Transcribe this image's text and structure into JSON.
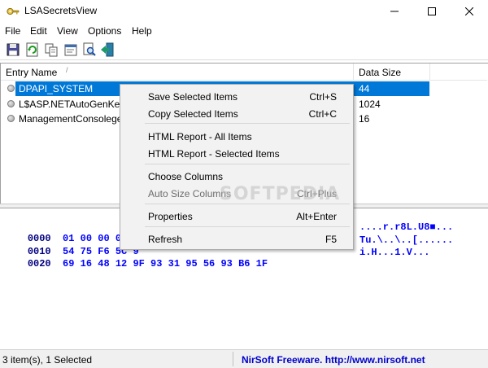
{
  "window": {
    "title": "LSASecretsView",
    "min_icon": "minimize-icon",
    "max_icon": "maximize-icon",
    "close_icon": "close-icon",
    "app_icon": "key-icon"
  },
  "menu": [
    {
      "label": "File"
    },
    {
      "label": "Edit"
    },
    {
      "label": "View"
    },
    {
      "label": "Options"
    },
    {
      "label": "Help"
    }
  ],
  "toolbar": [
    {
      "icon": "save-icon"
    },
    {
      "icon": "refresh-icon"
    },
    {
      "icon": "copy-icon"
    },
    {
      "icon": "properties-icon"
    },
    {
      "icon": "find-icon"
    },
    {
      "icon": "exit-icon"
    }
  ],
  "list": {
    "columns": [
      {
        "label": "Entry Name"
      },
      {
        "label": "Data Size"
      }
    ],
    "rows": [
      {
        "name": "DPAPI_SYSTEM",
        "size": "44",
        "selected": true
      },
      {
        "name": "L$ASP.NETAutoGenKeysV",
        "size": "1024",
        "selected": false
      },
      {
        "name": "ManagementConsolegen",
        "size": "16",
        "selected": false
      }
    ]
  },
  "hex": {
    "lines": [
      {
        "offset": "0000",
        "bytes": "01 00 00 00 7",
        "ascii": "....r.r8L.U8■..."
      },
      {
        "offset": "0010",
        "bytes": "54 75 F6 5C 9",
        "ascii": "Tu.\\..\\..[......"
      },
      {
        "offset": "0020",
        "bytes": "69 16 48 12 9F 93 31 95 56 93 B6 1F",
        "ascii": "i.H...1.V..."
      }
    ]
  },
  "context_menu": {
    "items": [
      {
        "label": "Save Selected Items",
        "accel": "Ctrl+S",
        "disabled": false
      },
      {
        "label": "Copy Selected Items",
        "accel": "Ctrl+C",
        "disabled": false
      },
      {
        "label": "HTML Report - All Items",
        "accel": "",
        "disabled": false
      },
      {
        "label": "HTML Report - Selected Items",
        "accel": "",
        "disabled": false
      },
      {
        "label": "Choose Columns",
        "accel": "",
        "disabled": false
      },
      {
        "label": "Auto Size Columns",
        "accel": "Ctrl+Plus",
        "disabled": true
      },
      {
        "label": "Properties",
        "accel": "Alt+Enter",
        "disabled": false
      },
      {
        "label": "Refresh",
        "accel": "F5",
        "disabled": false
      }
    ]
  },
  "watermark": "SOFTPEDIA",
  "status": {
    "count": "3 item(s), 1 Selected",
    "link": "NirSoft Freeware.  http://www.nirsoft.net"
  }
}
